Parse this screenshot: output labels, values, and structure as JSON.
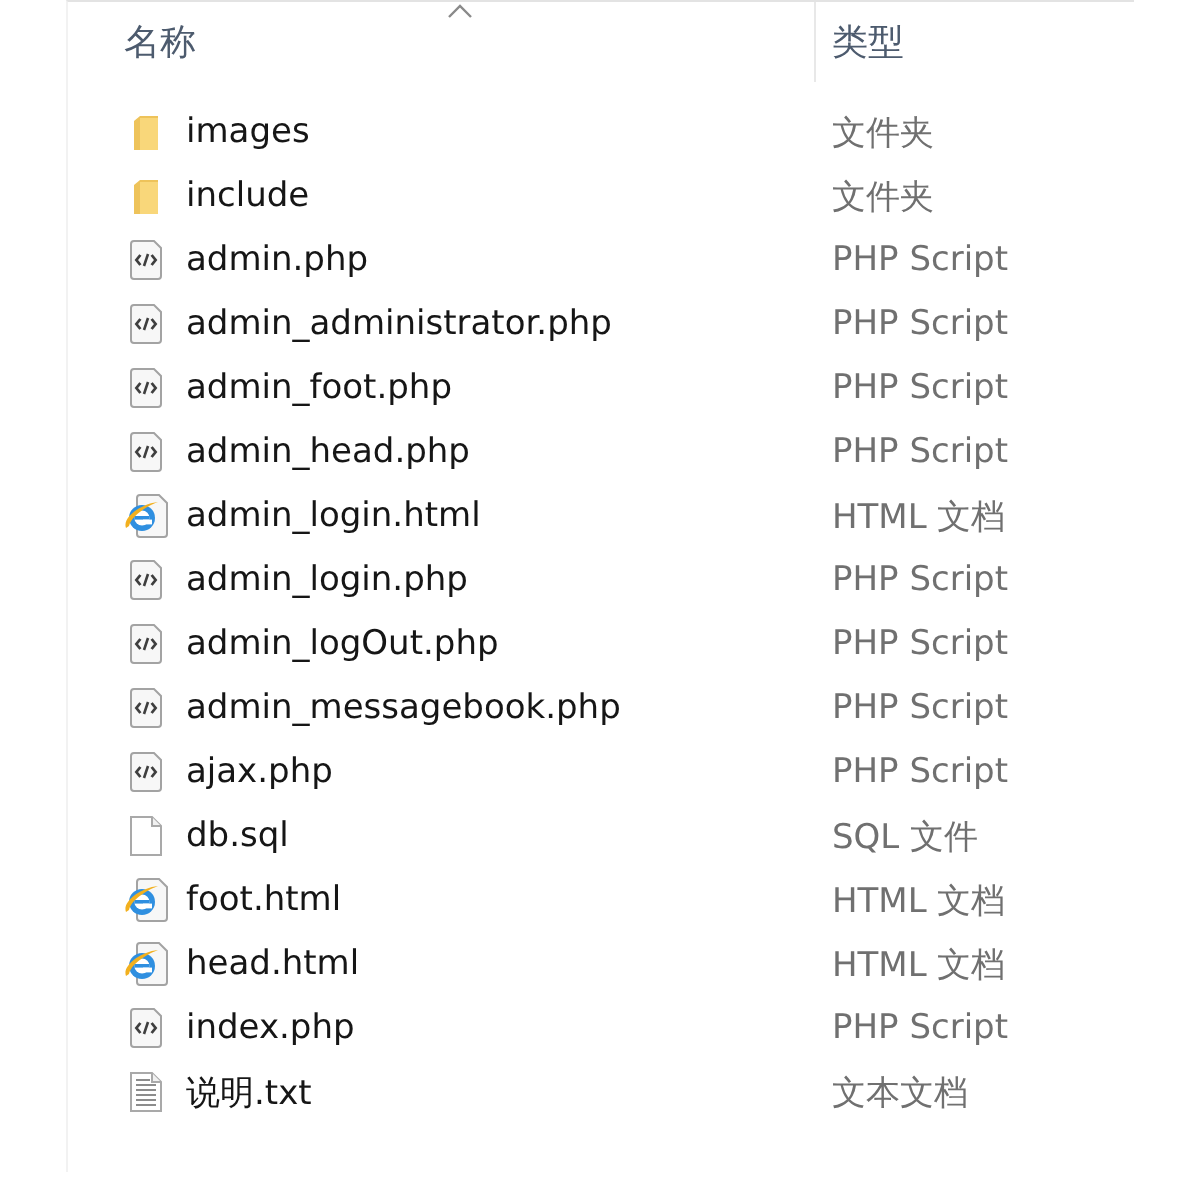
{
  "columns": [
    {
      "label": "名称",
      "sorted": true
    },
    {
      "label": "类型",
      "sorted": false
    }
  ],
  "files": [
    {
      "name": "images",
      "type": "文件夹",
      "kind": "folder"
    },
    {
      "name": "include",
      "type": "文件夹",
      "kind": "folder"
    },
    {
      "name": "admin.php",
      "type": "PHP Script",
      "kind": "code"
    },
    {
      "name": "admin_administrator.php",
      "type": "PHP Script",
      "kind": "code"
    },
    {
      "name": "admin_foot.php",
      "type": "PHP Script",
      "kind": "code"
    },
    {
      "name": "admin_head.php",
      "type": "PHP Script",
      "kind": "code"
    },
    {
      "name": "admin_login.html",
      "type": "HTML 文档",
      "kind": "web"
    },
    {
      "name": "admin_login.php",
      "type": "PHP Script",
      "kind": "code"
    },
    {
      "name": "admin_logOut.php",
      "type": "PHP Script",
      "kind": "code"
    },
    {
      "name": "admin_messagebook.php",
      "type": "PHP Script",
      "kind": "code"
    },
    {
      "name": "ajax.php",
      "type": "PHP Script",
      "kind": "code"
    },
    {
      "name": "db.sql",
      "type": "SQL 文件",
      "kind": "blank"
    },
    {
      "name": "foot.html",
      "type": "HTML 文档",
      "kind": "web"
    },
    {
      "name": "head.html",
      "type": "HTML 文档",
      "kind": "web"
    },
    {
      "name": "index.php",
      "type": "PHP Script",
      "kind": "code"
    },
    {
      "name": "说明.txt",
      "type": "文本文档",
      "kind": "text"
    }
  ]
}
